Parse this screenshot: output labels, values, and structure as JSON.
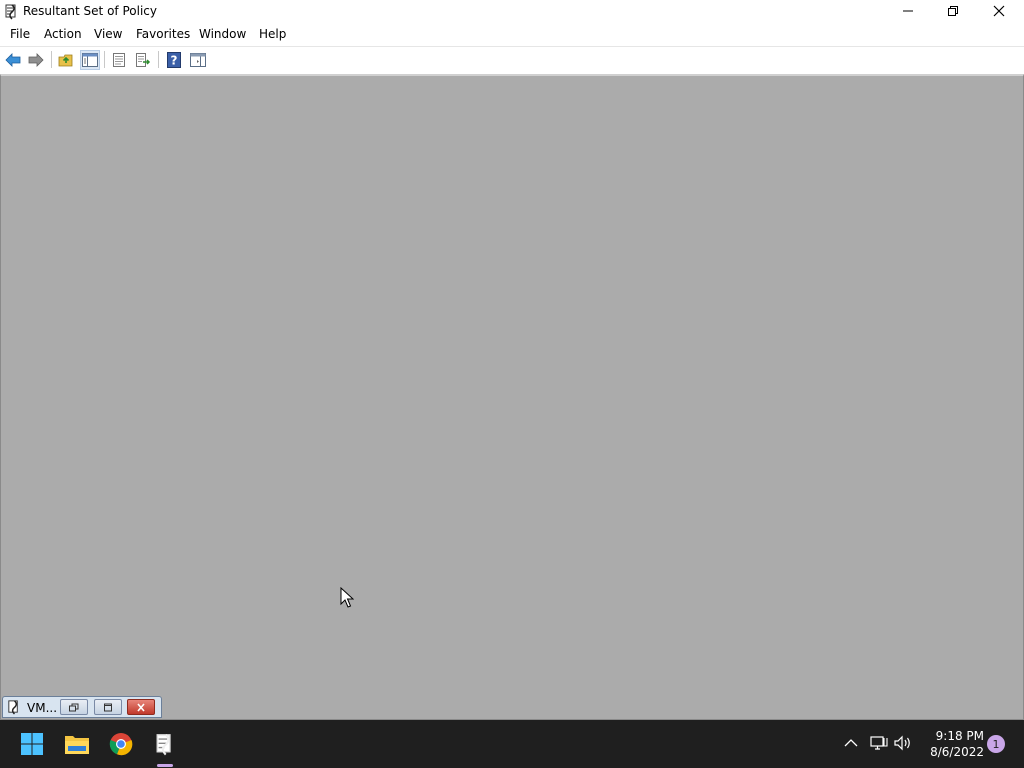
{
  "window": {
    "title": "Resultant Set of Policy",
    "controls": [
      "minimize",
      "restore",
      "close"
    ]
  },
  "menu": {
    "items": [
      "File",
      "Action",
      "View",
      "Favorites",
      "Window",
      "Help"
    ]
  },
  "toolbar": {
    "buttons": [
      "back-icon",
      "forward-icon",
      "up-folder-icon",
      "show-hide-console-tree-icon",
      "properties-icon",
      "export-list-icon",
      "help-icon",
      "action-pane-icon"
    ]
  },
  "minimized_child": {
    "label": "VM..."
  },
  "taskbar": {
    "apps": [
      "start-icon",
      "file-explorer-icon",
      "chrome-icon",
      "rsop-icon"
    ],
    "clock_time": "9:18 PM",
    "clock_date": "8/6/2022",
    "notification_count": "1"
  },
  "colors": {
    "mdi_background": "#ababab",
    "taskbar": "#1f1f1f",
    "accent": "#c9a6e8"
  }
}
